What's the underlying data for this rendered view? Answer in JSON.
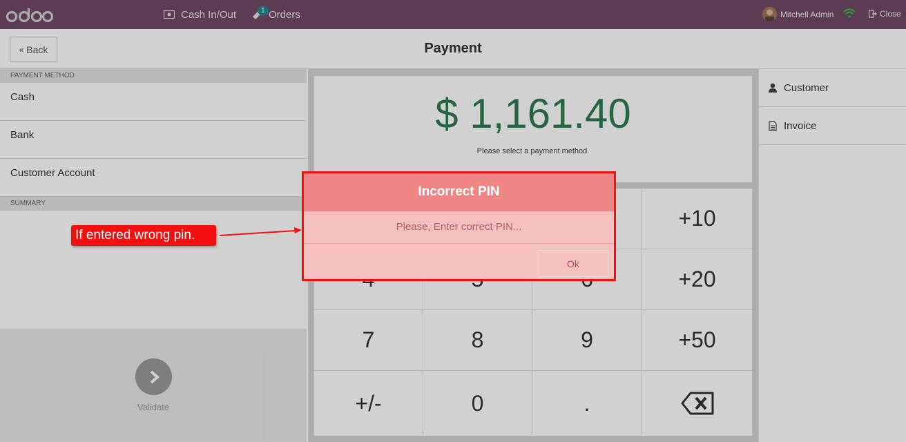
{
  "topbar": {
    "logo_text": "odoo",
    "cash_label": "Cash In/Out",
    "orders_label": "Orders",
    "orders_badge": "1",
    "user_name": "Mitchell Admin",
    "close_label": "Close"
  },
  "header": {
    "back_label": "Back",
    "title": "Payment"
  },
  "left": {
    "payment_method_heading": "PAYMENT METHOD",
    "methods": [
      "Cash",
      "Bank",
      "Customer Account"
    ],
    "summary_heading": "SUMMARY",
    "validate_label": "Validate"
  },
  "center": {
    "amount": "$ 1,161.40",
    "note": "Please select a payment method."
  },
  "keypad": {
    "keys": [
      "+10",
      "4",
      "5",
      "6",
      "+20",
      "7",
      "8",
      "9",
      "+50",
      "+/-",
      "0",
      ".",
      "backspace-icon"
    ]
  },
  "right": {
    "customer_label": "Customer",
    "invoice_label": "Invoice"
  },
  "popup": {
    "title": "Incorrect PIN",
    "message": "Please, Enter correct PIN...",
    "ok_label": "Ok"
  },
  "annotation": {
    "callout_text": "If entered wrong pin."
  },
  "colors": {
    "topbar": "#714b67",
    "amount": "#2e7d4f",
    "popup_header": "#f08585",
    "popup_border": "#f01010"
  }
}
